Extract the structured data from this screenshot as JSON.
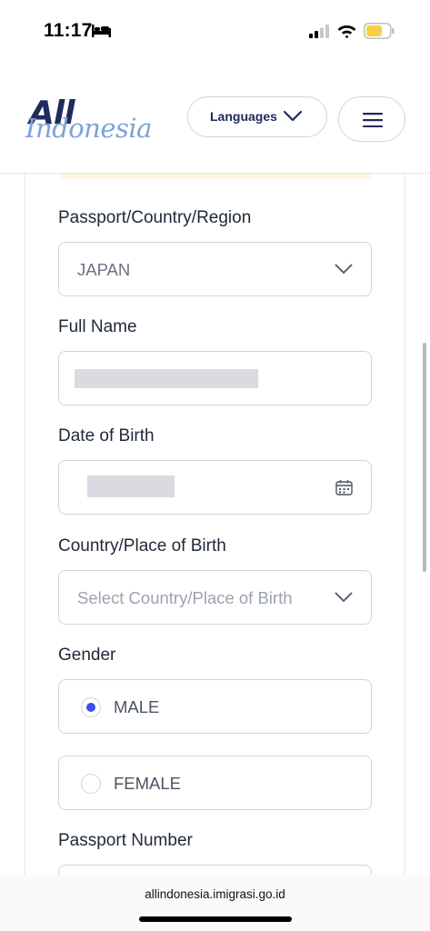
{
  "status_bar": {
    "time": "11:17",
    "icons": [
      "bed-icon",
      "signal-icon",
      "wifi-icon",
      "battery-icon"
    ]
  },
  "header": {
    "logo_primary": "All",
    "logo_secondary": "Indonesia",
    "languages_label": "Languages",
    "menu_icon": "hamburger-menu-icon"
  },
  "form": {
    "passport_country": {
      "label": "Passport/Country/Region",
      "value": "JAPAN"
    },
    "full_name": {
      "label": "Full Name",
      "value": ""
    },
    "date_of_birth": {
      "label": "Date of Birth",
      "value": ""
    },
    "place_of_birth": {
      "label": "Country/Place of Birth",
      "placeholder": "Select Country/Place of Birth"
    },
    "gender": {
      "label": "Gender",
      "options": [
        {
          "label": "MALE",
          "selected": true
        },
        {
          "label": "FEMALE",
          "selected": false
        }
      ]
    },
    "passport_number": {
      "label": "Passport Number"
    }
  },
  "browser": {
    "url": "allindonesia.imigrasi.go.id"
  },
  "colors": {
    "brand_navy": "#1e2b5c",
    "brand_light_blue": "#7da3d6",
    "radio_accent": "#3b4ff0",
    "battery_yellow": "#f7ce46"
  }
}
